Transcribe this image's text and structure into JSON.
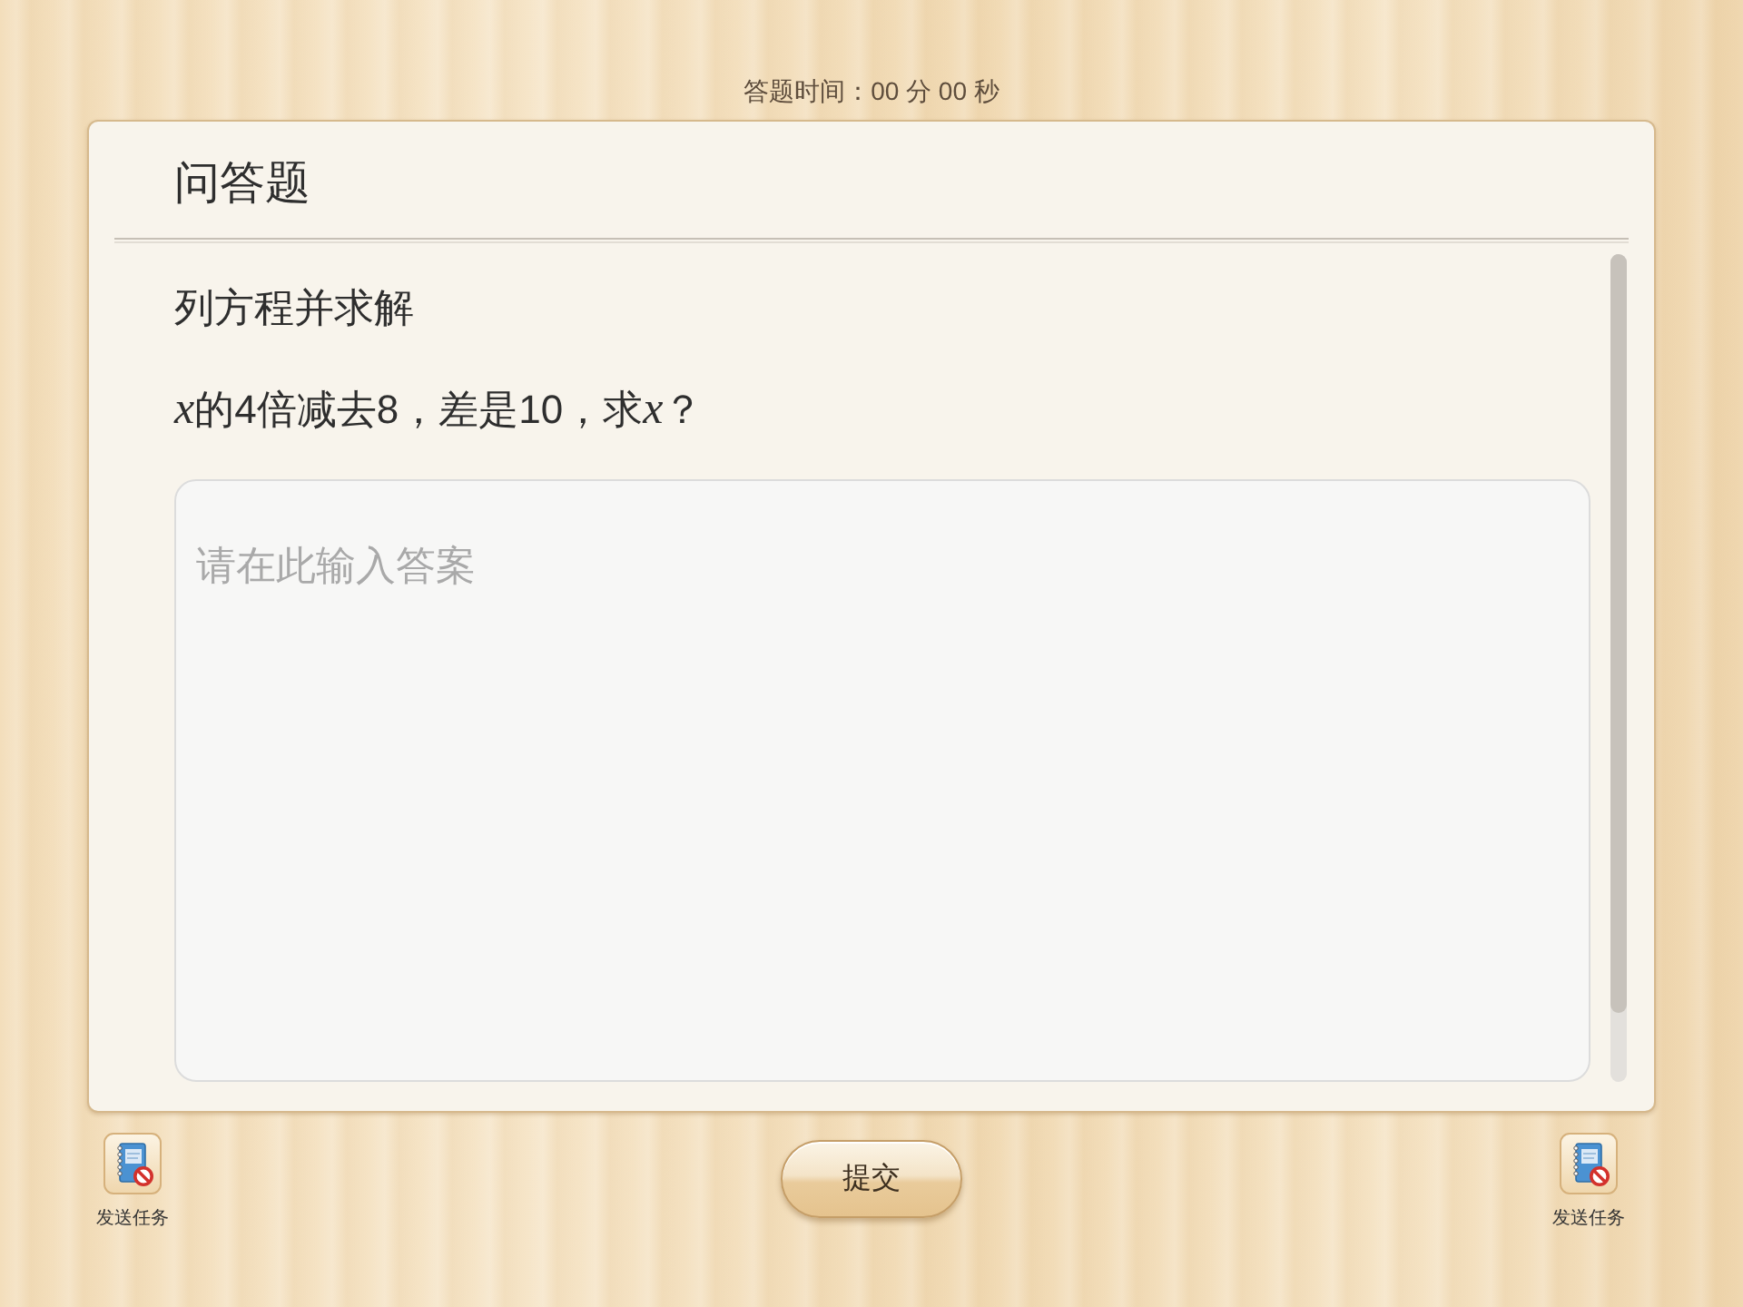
{
  "timer": {
    "text": "答题时间：00 分 00 秒"
  },
  "card": {
    "title": "问答题",
    "instruction": "列方程并求解",
    "question": [
      {
        "kind": "math",
        "text": "x"
      },
      {
        "kind": "plain",
        "text": "的4倍减去8，差是10，求"
      },
      {
        "kind": "math",
        "text": "x"
      },
      {
        "kind": "plain",
        "text": "？"
      }
    ],
    "answer": {
      "placeholder": "请在此输入答案"
    }
  },
  "footer": {
    "buttons": [
      {
        "kind": "task",
        "label": "发送任务"
      },
      {
        "kind": "submit",
        "label": "提交"
      },
      {
        "kind": "task",
        "label": "发送任务"
      }
    ]
  }
}
